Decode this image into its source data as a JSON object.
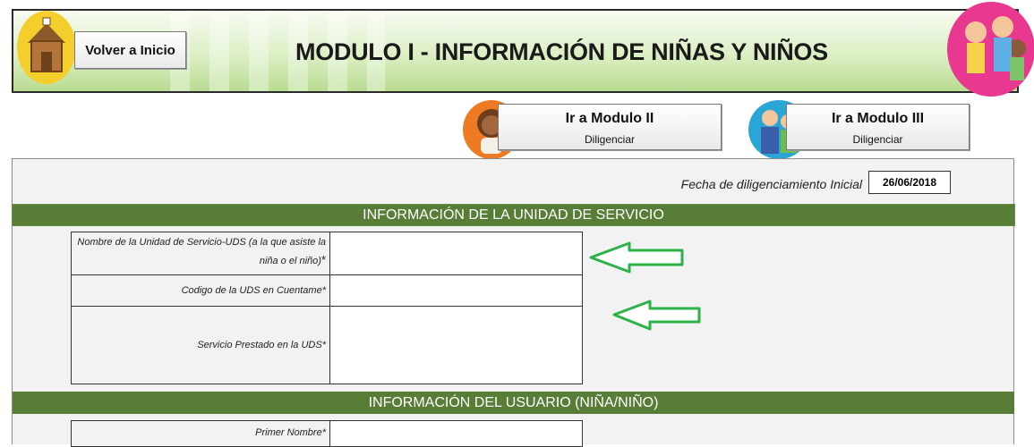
{
  "header": {
    "home_button": "Volver a Inicio",
    "title": "MODULO I - INFORMACIÓN DE NIÑAS Y NIÑOS"
  },
  "nav": {
    "module2": {
      "label": "Ir a Modulo II",
      "sublabel": "Diligenciar"
    },
    "module3": {
      "label": "Ir a Modulo III",
      "sublabel": "Diligenciar"
    }
  },
  "form": {
    "fecha_label": "Fecha de diligenciamiento Inicial",
    "fecha_value": "26/06/2018",
    "section_service": "INFORMACIÓN DE LA UNIDAD DE SERVICIO",
    "field_uds_name_line1": "Nombre de la Unidad de Servicio-UDS (a la que asiste la",
    "field_uds_name_line2": "niña o el niño)",
    "field_uds_code": "Codigo de la UDS en Cuentame*",
    "field_service": "Servicio Prestado en la UDS*",
    "section_user": "INFORMACIÓN DEL USUARIO (NIÑA/NIÑO)",
    "field_first_name": "Primer Nombre*"
  },
  "colors": {
    "section_green": "#577d36",
    "arrow_green": "#2bb34a",
    "home_badge": "#f4cf2c",
    "kids_badge": "#e8388f"
  }
}
